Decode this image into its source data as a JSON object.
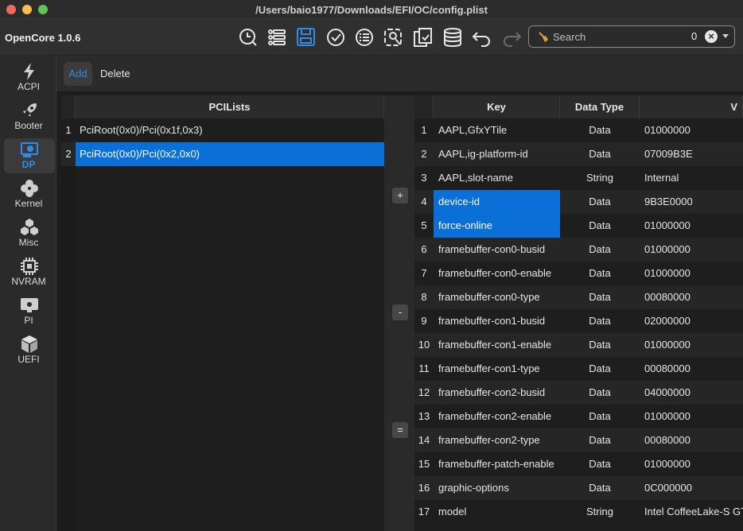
{
  "window": {
    "title": "/Users/baio1977/Downloads/EFI/OC/config.plist",
    "traffic_lights": [
      "#ec6a5e",
      "#f4bf4f",
      "#61c554"
    ]
  },
  "toolbar": {
    "app_title": "OpenCore 1.0.6",
    "icons": [
      "clock-search-icon",
      "list-icon",
      "save-icon",
      "check-icon",
      "list-check-icon",
      "wrench-gear-icon",
      "document-edit-icon",
      "database-icon",
      "undo-icon",
      "redo-icon"
    ],
    "search": {
      "placeholder": "Search",
      "count": "0"
    }
  },
  "sidebar": {
    "items": [
      {
        "label": "ACPI",
        "icon": "bolt-icon"
      },
      {
        "label": "Booter",
        "icon": "rocket-icon"
      },
      {
        "label": "DP",
        "icon": "display-card-icon",
        "active": true
      },
      {
        "label": "Kernel",
        "icon": "kernel-icon"
      },
      {
        "label": "Misc",
        "icon": "cubes-icon"
      },
      {
        "label": "NVRAM",
        "icon": "chip-icon"
      },
      {
        "label": "PI",
        "icon": "apple-display-icon"
      },
      {
        "label": "UEFI",
        "icon": "box-icon"
      }
    ],
    "accent": "#2f8ce8"
  },
  "subbar": {
    "add_label": "Add",
    "delete_label": "Delete"
  },
  "left_table": {
    "header": "PCILists",
    "rows": [
      {
        "num": "1",
        "path": "PciRoot(0x0)/Pci(0x1f,0x3)"
      },
      {
        "num": "2",
        "path": "PciRoot(0x0)/Pci(0x2,0x0)"
      }
    ]
  },
  "middle_buttons": {
    "plus": "+",
    "minus": "-",
    "equals": "="
  },
  "right_table": {
    "headers": {
      "key": "Key",
      "type": "Data Type",
      "value": "V"
    },
    "rows": [
      {
        "num": "1",
        "key": "AAPL,GfxYTile",
        "type": "Data",
        "value": "01000000"
      },
      {
        "num": "2",
        "key": "AAPL,ig-platform-id",
        "type": "Data",
        "value": "07009B3E"
      },
      {
        "num": "3",
        "key": "AAPL,slot-name",
        "type": "String",
        "value": "Internal"
      },
      {
        "num": "4",
        "key": "device-id",
        "type": "Data",
        "value": "9B3E0000"
      },
      {
        "num": "5",
        "key": "force-online",
        "type": "Data",
        "value": "01000000"
      },
      {
        "num": "6",
        "key": "framebuffer-con0-busid",
        "type": "Data",
        "value": "01000000"
      },
      {
        "num": "7",
        "key": "framebuffer-con0-enable",
        "type": "Data",
        "value": "01000000"
      },
      {
        "num": "8",
        "key": "framebuffer-con0-type",
        "type": "Data",
        "value": "00080000"
      },
      {
        "num": "9",
        "key": "framebuffer-con1-busid",
        "type": "Data",
        "value": "02000000"
      },
      {
        "num": "10",
        "key": "framebuffer-con1-enable",
        "type": "Data",
        "value": "01000000"
      },
      {
        "num": "11",
        "key": "framebuffer-con1-type",
        "type": "Data",
        "value": "00080000"
      },
      {
        "num": "12",
        "key": "framebuffer-con2-busid",
        "type": "Data",
        "value": "04000000"
      },
      {
        "num": "13",
        "key": "framebuffer-con2-enable",
        "type": "Data",
        "value": "01000000"
      },
      {
        "num": "14",
        "key": "framebuffer-con2-type",
        "type": "Data",
        "value": "00080000"
      },
      {
        "num": "15",
        "key": "framebuffer-patch-enable",
        "type": "Data",
        "value": "01000000"
      },
      {
        "num": "16",
        "key": "graphic-options",
        "type": "Data",
        "value": "0C000000"
      },
      {
        "num": "17",
        "key": "model",
        "type": "String",
        "value": "Intel CoffeeLake-S GT"
      }
    ]
  }
}
